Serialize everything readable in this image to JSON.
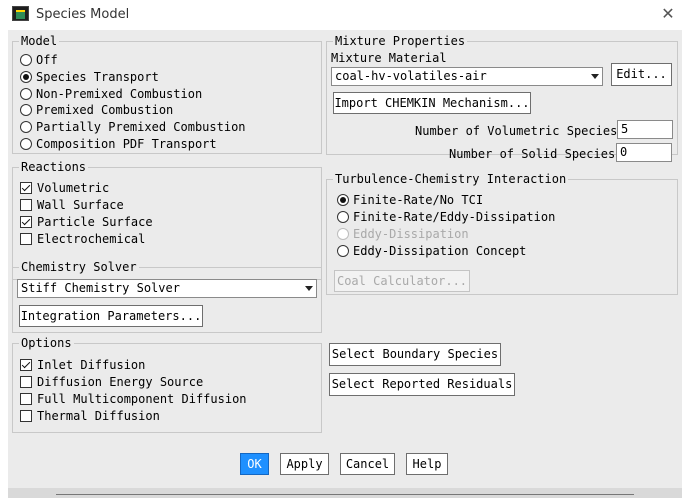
{
  "window": {
    "title": "Species Model",
    "close_glyph": "✕"
  },
  "model": {
    "title": "Model",
    "options": [
      {
        "label": "Off",
        "checked": false
      },
      {
        "label": "Species Transport",
        "checked": true
      },
      {
        "label": "Non-Premixed Combustion",
        "checked": false
      },
      {
        "label": "Premixed Combustion",
        "checked": false
      },
      {
        "label": "Partially Premixed Combustion",
        "checked": false
      },
      {
        "label": "Composition PDF Transport",
        "checked": false
      }
    ]
  },
  "reactions": {
    "title": "Reactions",
    "options": [
      {
        "label": "Volumetric",
        "checked": true
      },
      {
        "label": "Wall Surface",
        "checked": false
      },
      {
        "label": "Particle Surface",
        "checked": true
      },
      {
        "label": "Electrochemical",
        "checked": false
      }
    ]
  },
  "chemistry_solver": {
    "title": "Chemistry Solver",
    "selected": "Stiff Chemistry Solver",
    "integration_button": "Integration Parameters..."
  },
  "options": {
    "title": "Options",
    "items": [
      {
        "label": "Inlet Diffusion",
        "checked": true
      },
      {
        "label": "Diffusion Energy Source",
        "checked": false
      },
      {
        "label": "Full Multicomponent Diffusion",
        "checked": false
      },
      {
        "label": "Thermal Diffusion",
        "checked": false
      }
    ]
  },
  "mixture": {
    "title": "Mixture Properties",
    "material_label": "Mixture Material",
    "material_value": "coal-hv-volatiles-air",
    "edit_button": "Edit...",
    "import_button": "Import CHEMKIN Mechanism...",
    "vol_species_label": "Number of Volumetric Species",
    "vol_species_value": "5",
    "solid_species_label": "Number of Solid Species",
    "solid_species_value": "0"
  },
  "tci": {
    "title": "Turbulence-Chemistry Interaction",
    "options": [
      {
        "label": "Finite-Rate/No TCI",
        "checked": true,
        "disabled": false
      },
      {
        "label": "Finite-Rate/Eddy-Dissipation",
        "checked": false,
        "disabled": false
      },
      {
        "label": "Eddy-Dissipation",
        "checked": false,
        "disabled": true
      },
      {
        "label": "Eddy-Dissipation Concept",
        "checked": false,
        "disabled": false
      }
    ],
    "coal_button": "Coal Calculator..."
  },
  "side_buttons": {
    "boundary": "Select Boundary Species",
    "residuals": "Select Reported Residuals"
  },
  "footer": {
    "ok": "OK",
    "apply": "Apply",
    "cancel": "Cancel",
    "help": "Help"
  },
  "colors": {
    "ok_button": "#1e90ff",
    "dialog_bg": "#ebebeb",
    "group_border": "#c8c8c8"
  }
}
